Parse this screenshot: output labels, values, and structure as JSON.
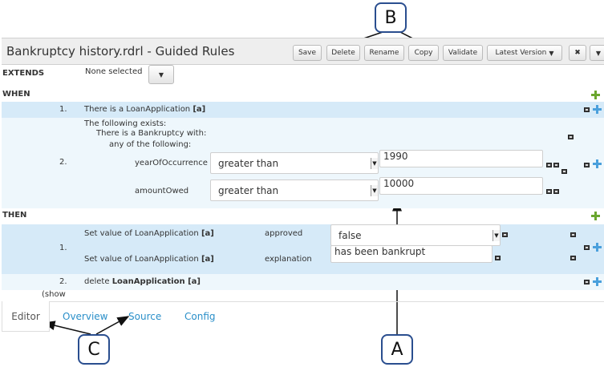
{
  "callouts": {
    "a": "A",
    "b": "B",
    "c": "C"
  },
  "header": {
    "title": "Bankruptcy history.rdrl - Guided Rules",
    "buttons": {
      "save": "Save",
      "delete": "Delete",
      "rename": "Rename",
      "copy": "Copy",
      "validate": "Validate",
      "latest_version": "Latest Version",
      "close": "✖"
    }
  },
  "extends": {
    "label": "EXTENDS",
    "value": "None selected"
  },
  "when": {
    "label": "WHEN",
    "row1": {
      "num": "1.",
      "text": "There is a LoanApplication ",
      "bound": "[a]"
    },
    "row2": {
      "num": "2.",
      "line1": "The following exists:",
      "line2": "There is a Bankruptcy with:",
      "line3": "any of the following:",
      "field1": {
        "name": "yearOfOccurrence",
        "operator": "greater than",
        "value": "1990"
      },
      "field2": {
        "name": "amountOwed",
        "operator": "greater than",
        "value": "10000"
      }
    }
  },
  "then": {
    "label": "THEN",
    "row1": {
      "num": "1.",
      "a1_prefix": "Set value of LoanApplication ",
      "a1_bound": "[a]",
      "a1_field": "approved",
      "a1_value": "false",
      "a2_prefix": "Set value of LoanApplication ",
      "a2_bound": "[a]",
      "a2_field": "explanation",
      "a2_value": "has been bankrupt"
    },
    "row2": {
      "num": "2.",
      "prefix": "delete ",
      "target": "LoanApplication [a]"
    },
    "show": "(show"
  },
  "tabs": {
    "editor": "Editor",
    "overview": "Overview",
    "source": "Source",
    "config": "Config"
  }
}
